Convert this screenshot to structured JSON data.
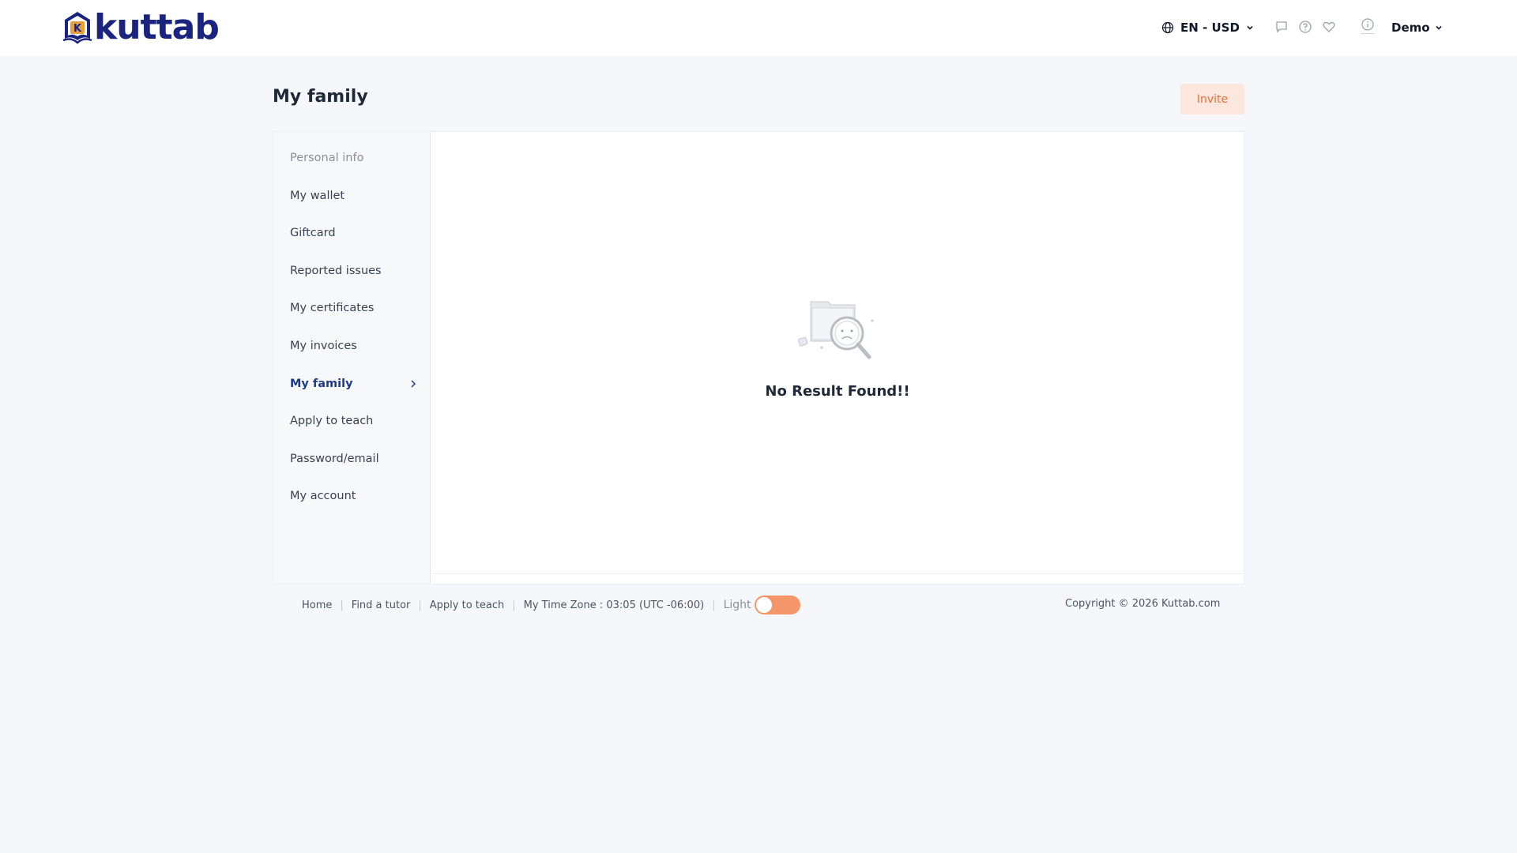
{
  "header": {
    "logo_text": "kuttab",
    "logo_letter": "K",
    "language_label": "EN - USD",
    "user_name": "Demo",
    "icons": [
      "globe-icon",
      "chat-icon",
      "help-icon",
      "heart-icon",
      "info-icon",
      "chevron-down-icon"
    ]
  },
  "page": {
    "title": "My family",
    "invite_label": "Invite"
  },
  "sidebar": {
    "items": [
      {
        "label": "Personal info",
        "state": "muted"
      },
      {
        "label": "My wallet"
      },
      {
        "label": "Giftcard"
      },
      {
        "label": "Reported issues"
      },
      {
        "label": "My certificates"
      },
      {
        "label": "My invoices"
      },
      {
        "label": "My family",
        "state": "active"
      },
      {
        "label": "Apply to teach"
      },
      {
        "label": "Password/email"
      },
      {
        "label": "My account"
      }
    ]
  },
  "content": {
    "empty_message": "No Result Found!!"
  },
  "footer": {
    "links": [
      "Home",
      "Find a tutor",
      "Apply to teach"
    ],
    "timezone": "My Time Zone : 03:05 (UTC -06:00)",
    "theme_label": "Light",
    "copyright": "Copyright © 2026 Kuttab.com"
  },
  "colors": {
    "brand_navy": "#1a237e",
    "accent_orange": "#e8703a",
    "active_link": "#1e3a8a",
    "toggle_bg": "#f4956a"
  }
}
